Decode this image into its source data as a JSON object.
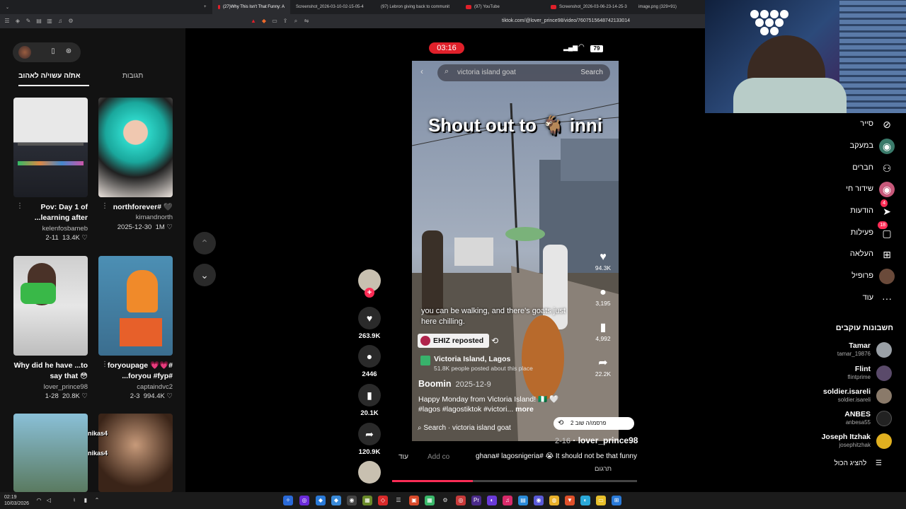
{
  "browser": {
    "tabs": [
      {
        "label": "(27)Why This Isn't That Funny: A",
        "active": true
      },
      {
        "label": "Screenshot_2026-03-10-02-15-05-4",
        "active": false
      },
      {
        "label": "(97) Lebron giving back to communit",
        "active": false
      },
      {
        "label": "(97) YouTube",
        "active": false
      },
      {
        "label": "Screenshot_2026-03-06-23-14-25-3",
        "active": false
      },
      {
        "label": "image.png (329×91)",
        "active": false
      }
    ],
    "url": "tiktok.com/@lover_prince98/video/7607515648742133014"
  },
  "left_panel": {
    "tab_liked": "את/ה עשוי/ה לאהוב",
    "tab_comments": "תגובות",
    "videos": [
      {
        "title": "Pov: Day 1 of ...learning after",
        "author": "kelenfosbameb",
        "date": "2-11",
        "likes": "13.4K ♡"
      },
      {
        "title": "northforever# 🖤",
        "author": "kimandnorth",
        "date": "2025-12-30",
        "likes": "1M ♡"
      },
      {
        "title": "Why did he have ...to say that 😳",
        "author": "lover_prince98",
        "date": "1-28",
        "likes": "20.8K ♡"
      },
      {
        "title": "foryoupage 💗💗# ...foryou #fyp#",
        "author": "captaindvc2",
        "date": "2-3",
        "likes": "994.4K ♡"
      },
      {
        "title": "",
        "author": "",
        "date": "",
        "likes": ""
      },
      {
        "title": "",
        "author": "",
        "date": "",
        "likes": ""
      }
    ]
  },
  "video": {
    "time": "03:16",
    "battery": "79",
    "search_query": "victoria island goat",
    "search_button": "Search",
    "caption": "Shout out to 🐐 inni",
    "subtitle": "you can be walking, and there's goats just here chilling.",
    "repost_label": "EHIZ reposted",
    "location_name": "Victoria Island, Lagos",
    "location_sub": "51.8K people posted about this place",
    "author": "Boomin",
    "date": "2025-12-9",
    "description": "Happy Monday from Victoria Island! 🇳🇬 🤍 #lagos #lagostiktok #victori...",
    "more": "more",
    "bottom_search": "Search · victoria island goat",
    "likes": "94.3K",
    "comments": "3,195",
    "saves": "4,992",
    "shares": "22.2K"
  },
  "actions": {
    "likes": "263.9K",
    "comments": "2446",
    "saves": "20.1K",
    "shares": "120.9K"
  },
  "post": {
    "shared_by": "2 פרסמו/ה שוב",
    "username": "lover_prince98",
    "date": "2-16",
    "caption": "ghana# lagosnigeria# 😭 It should not be that funny",
    "translate": "תרגום",
    "comment_placeholder": "Add co",
    "more": "עוד"
  },
  "right_nav": [
    {
      "label": "סייר",
      "icon": "compass-icon"
    },
    {
      "label": "במעקב",
      "icon": "following-icon"
    },
    {
      "label": "חברים",
      "icon": "friends-icon"
    },
    {
      "label": "שידור חי",
      "icon": "live-icon"
    },
    {
      "label": "הודעות",
      "icon": "messages-icon",
      "badge": "4"
    },
    {
      "label": "פעילות",
      "icon": "activity-icon",
      "badge": "18"
    },
    {
      "label": "העלאה",
      "icon": "upload-icon"
    },
    {
      "label": "פרופיל",
      "icon": "profile-icon"
    },
    {
      "label": "עוד",
      "icon": "more-icon"
    }
  ],
  "following_section": "חשבונות עוקבים",
  "following": [
    {
      "name": "Tamar",
      "handle": "tamar_19876"
    },
    {
      "name": "Flint",
      "handle": "flintprime"
    },
    {
      "name": "soldier.isareli",
      "handle": "soldier.isareli"
    },
    {
      "name": "ANBES",
      "handle": "anbesa55"
    },
    {
      "name": "Joseph Itzhak",
      "handle": "josephitzhak"
    }
  ],
  "show_all": "להציג הכול",
  "chat": [
    "nikas4",
    "nikas4"
  ],
  "taskbar": {
    "time": "02:19",
    "date": "10/03/2026"
  }
}
